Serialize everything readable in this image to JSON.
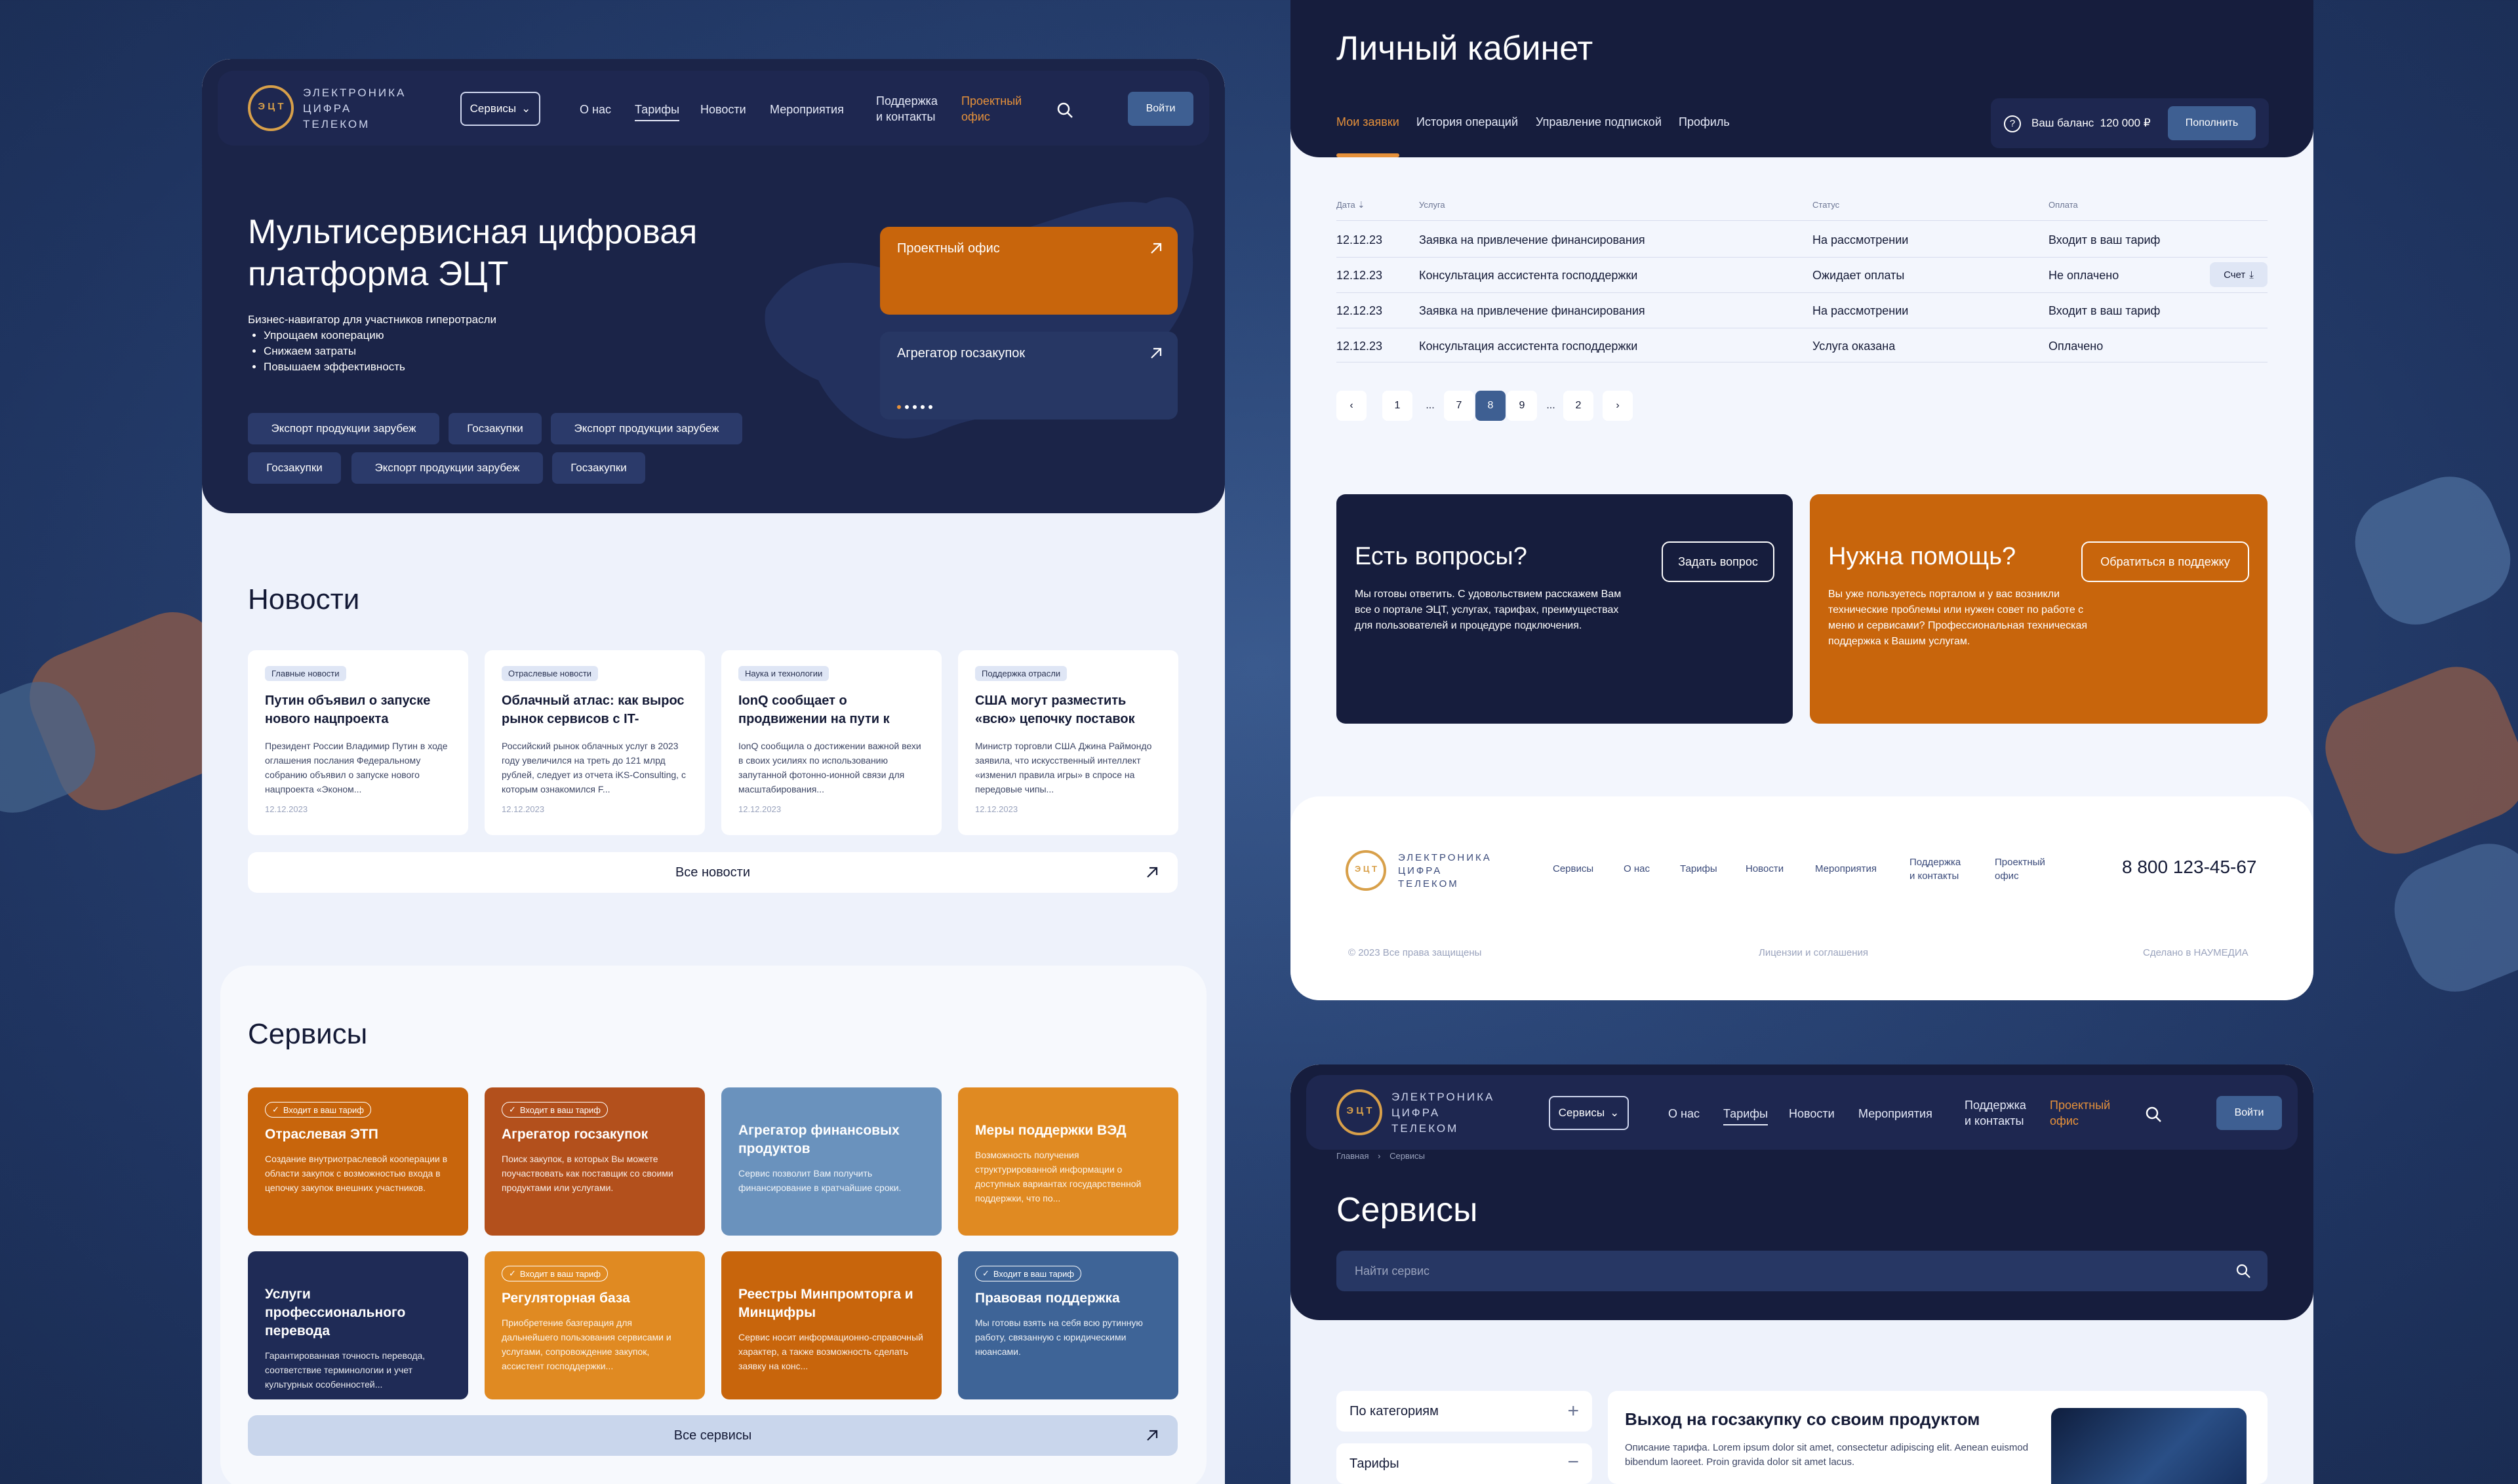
{
  "brand": {
    "line1": "Электроника",
    "line2": "цифра",
    "line3": "телеком",
    "logo_letters": "Э Ц Т"
  },
  "nav": {
    "services": "Сервисы",
    "about": "О нас",
    "tariffs": "Тарифы",
    "news": "Новости",
    "events": "Мероприятия",
    "support_line1": "Поддержка",
    "support_line2": "и контакты",
    "office_line1": "Проектный",
    "office_line2": "офис",
    "login": "Войти"
  },
  "hero": {
    "title_line1": "Мультисервисная цифровая",
    "title_line2": "платформа ЭЦТ",
    "subtitle": "Бизнес-навигатор для участников гиперотрасли",
    "bullets": [
      "Упрощаем кооперацию",
      "Снижаем затраты",
      "Повышаем эффективность"
    ],
    "chips": [
      "Экспорт продукции зарубеж",
      "Госзакупки",
      "Экспорт продукции зарубеж",
      "Госзакупки",
      "Экспорт продукции зарубеж",
      "Госзакупки"
    ],
    "card1": "Проектный офис",
    "card2": "Агрегатор госзакупок"
  },
  "news": {
    "title": "Новости",
    "all": "Все новости",
    "items": [
      {
        "tag": "Главные новости",
        "title": "Путин объявил о запуске нового нацпроекта «Эконом...",
        "body": "Президент России Владимир Путин в ходе оглашения послания Федеральному собранию объявил о запуске нового нацпроекта «Эконом...",
        "date": "12.12.2023"
      },
      {
        "tag": "Отраслевые новости",
        "title": "Облачный атлас: как вырос рынок сервисов с IT-инфрас...",
        "body": "Российский рынок облачных услуг в 2023 году увеличился на треть до 121 млрд рублей, следует из отчета iKS-Consulting, с которым ознакомился F...",
        "date": "12.12.2023"
      },
      {
        "tag": "Наука и технологии",
        "title": "IonQ сообщает о продвижении на пути к сете...",
        "body": "IonQ сообщила о достижении важной вехи в своих усилиях по использованию запутанной фотонно-ионной связи для масштабирования...",
        "date": "12.12.2023"
      },
      {
        "tag": "Поддержка отрасли",
        "title": "США могут разместить «всю» цепочку поставок передовы...",
        "body": "Министр торговли США Джина Раймондо заявила, что искусственный интеллект «изменил правила игры» в спросе на передовые чипы...",
        "date": "12.12.2023"
      }
    ]
  },
  "services": {
    "title": "Сервисы",
    "all": "Все сервисы",
    "badge": "Входит в ваш тариф",
    "items": [
      {
        "title": "Отраслевая ЭТП",
        "desc": "Создание внутриотраслевой кооперации в области закупок с возможностью входа в цепочку закупок внешних участников.",
        "color": "#c8650c",
        "badge": true
      },
      {
        "title": "Агрегатор госзакупок",
        "desc": "Поиск закупок, в которых Вы можете поучаствовать как поставщик со своими продуктами или услугами.",
        "color": "#b3501c",
        "badge": true
      },
      {
        "title": "Агрегатор финансовых продуктов",
        "desc": "Сервис позволит Вам получить финансирование в кратчайшие сроки.",
        "color": "#6a92bd",
        "badge": false
      },
      {
        "title": "Меры поддержки ВЭД",
        "desc": "Возможность получения структурированной информации о доступных вариантах государственной поддержки, что по...",
        "color": "#e08a22",
        "badge": false
      },
      {
        "title": "Услуги профессионального перевода",
        "desc": "Гарантированная точность перевода, соответствие терминологии и учет культурных особенностей...",
        "color": "#1f2b56",
        "badge": false
      },
      {
        "title": "Регуляторная база",
        "desc": "Приобретение базгерация для дальнейшего пользования сервисами и услугами, сопровождение закупок, ассистент господдержки...",
        "color": "#e08a22",
        "badge": true
      },
      {
        "title": "Реестры Минпромторга и Минцифры",
        "desc": "Сервис носит информационно-справочный характер, а также возможность сделать заявку на конс...",
        "color": "#c8650c",
        "badge": false
      },
      {
        "title": "Правовая поддержка",
        "desc": "Мы готовы взять на себя всю рутинную работу, связанную с юридическими нюансами.",
        "color": "#3e6497",
        "badge": true
      }
    ]
  },
  "cabinet": {
    "title": "Личный кабинет",
    "tabs": [
      "Мои заявки",
      "История операций",
      "Управление подпиской",
      "Профиль"
    ],
    "balance_label": "Ваш баланс",
    "balance": "120 000 ₽",
    "topup": "Пополнить",
    "columns": [
      "Дата",
      "Услуга",
      "Статус",
      "Оплата"
    ],
    "rows": [
      {
        "date": "12.12.23",
        "service": "Заявка на привлечение финансирования",
        "status": "На рассмотрении",
        "pay": "Входит в ваш тариф"
      },
      {
        "date": "12.12.23",
        "service": "Консультация ассистента господдержки",
        "status": "Ожидает оплаты",
        "pay": "Не оплачено"
      },
      {
        "date": "12.12.23",
        "service": "Заявка на привлечение финансирования",
        "status": "На рассмотрении",
        "pay": "Входит в ваш тариф"
      },
      {
        "date": "12.12.23",
        "service": "Консультация ассистента господдержки",
        "status": "Услуга оказана",
        "pay": "Оплачено"
      }
    ],
    "invoice": "Счет",
    "pages": [
      "1",
      "...",
      "7",
      "8",
      "9",
      "...",
      "2"
    ],
    "active_page": "8"
  },
  "help": {
    "q_title": "Есть вопросы?",
    "q_text": "Мы готовы ответить. С удовольствием расскажем Вам все о портале ЭЦТ, услугах, тарифах, преимуществах для пользователей и процедуре подключения.",
    "q_btn": "Задать вопрос",
    "h_title": "Нужна помощь?",
    "h_text": "Вы уже пользуетесь порталом и у вас возникли технические проблемы или нужен совет по работе с меню и сервисами? Профессиональная техническая поддержка к Вашим услугам.",
    "h_btn": "Обратиться в поддежку"
  },
  "footer": {
    "phone": "8 800 123-45-67",
    "copyright": "© 2023 Все права защищены",
    "license": "Лицензии и соглашения",
    "made": "Сделано в НАУМЕДИА"
  },
  "catalog": {
    "crumb_home": "Главная",
    "crumb_sep": "›",
    "crumb_current": "Сервисы",
    "title": "Сервисы",
    "search_placeholder": "Найти сервис",
    "filter1": "По категориям",
    "filter2": "Тарифы",
    "promo_title": "Выход на госзакупку со своим продуктом",
    "promo_text": "Описание тарифа. Lorem ipsum dolor sit amet, consectetur adipiscing elit. Aenean euismod bibendum laoreet. Proin gravida dolor sit amet lacus."
  },
  "colors": {
    "navy": "#161d3d",
    "orange": "#c8650c",
    "accent_blue": "#3e5f92",
    "page_bg": "#eef2fb"
  }
}
